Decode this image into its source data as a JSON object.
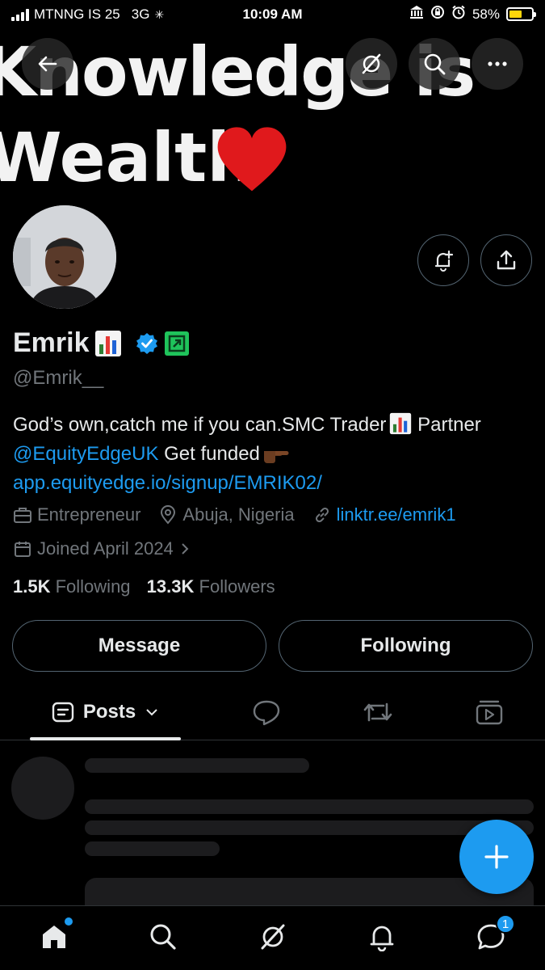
{
  "status_bar": {
    "carrier": "MTNNG IS 25",
    "network": "3G",
    "time": "10:09 AM",
    "battery": "58%",
    "battery_level": 0.58
  },
  "banner": {
    "line1": "Knowledge is",
    "line2": "Wealth"
  },
  "profile": {
    "name": "Emrik",
    "handle": "@Emrik__",
    "bio_text1": "God’s own,catch me if you can.SMC Trader",
    "bio_text2": " Partner ",
    "bio_mention": "@EquityEdgeUK",
    "bio_text3": " Get funded",
    "bio_link": "app.equityedge.io/signup/EMRIK02/",
    "category": "Entrepreneur",
    "location": "Abuja, Nigeria",
    "website": "linktr.ee/emrik1",
    "joined": "Joined April 2024",
    "following_count": "1.5K",
    "following_label": "Following",
    "followers_count": "13.3K",
    "followers_label": "Followers"
  },
  "actions": {
    "message_label": "Message",
    "following_label": "Following"
  },
  "tabs": {
    "posts_label": "Posts"
  },
  "nav": {
    "messages_badge": "1"
  },
  "colors": {
    "accent": "#1d9bf0",
    "verified": "#1d9bf0",
    "heart": "#e0191c"
  }
}
